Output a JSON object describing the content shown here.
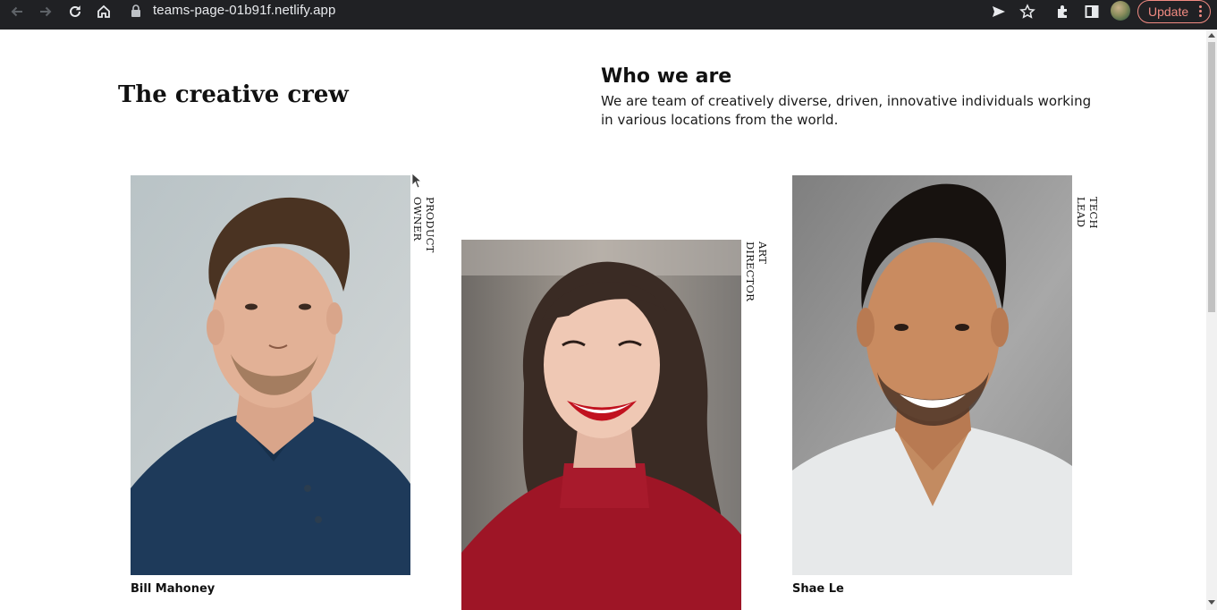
{
  "browser": {
    "url": "teams-page-01b91f.netlify.app",
    "update_label": "Update",
    "icons": [
      "back-arrow-icon",
      "forward-arrow-icon",
      "reload-icon",
      "home-icon",
      "lock-icon",
      "send-icon",
      "star-icon",
      "extensions-icon",
      "sidebar-icon",
      "profile-avatar",
      "more-vert-icon"
    ],
    "colors": {
      "chrome_bg": "#202124",
      "update_accent": "#f28b82"
    }
  },
  "page": {
    "title": "The creative crew",
    "who_title": "Who we are",
    "who_text": "We are team of creatively diverse, driven, innovative individuals working in various locations from the world."
  },
  "team": [
    {
      "name": "Bill Mahoney",
      "role": "PRODUCT OWNER",
      "photo": "man-navy-polo-portrait"
    },
    {
      "name": "",
      "role": "ART DIRECTOR",
      "photo": "woman-red-sweater-smiling-portrait"
    },
    {
      "name": "Shae Le",
      "role": "TECH LEAD",
      "photo": "man-white-tshirt-smiling-portrait"
    }
  ]
}
